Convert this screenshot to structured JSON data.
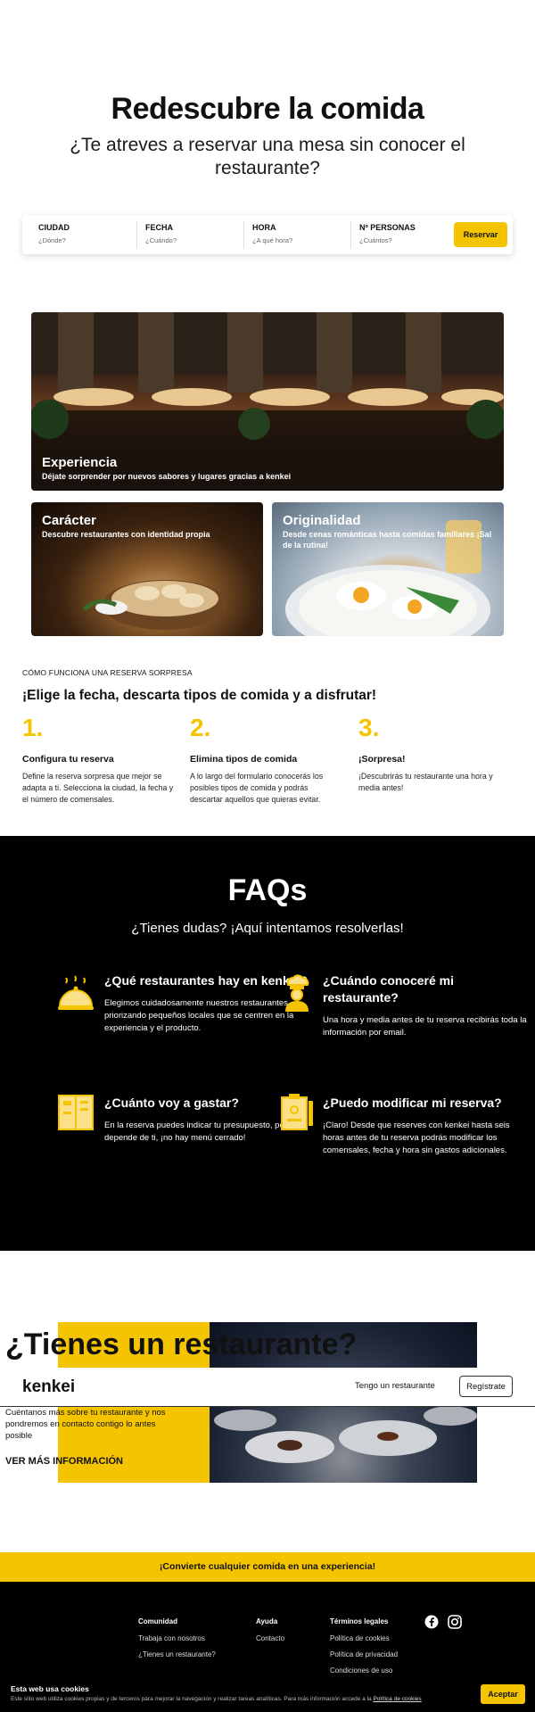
{
  "hero": {
    "title": "Redescubre la comida",
    "subtitle": "¿Te atreves a reservar una mesa sin conocer el restaurante?"
  },
  "search": {
    "fields": [
      {
        "label": "CIUDAD",
        "placeholder": "¿Dónde?"
      },
      {
        "label": "FECHA",
        "placeholder": "¿Cuándo?"
      },
      {
        "label": "HORA",
        "placeholder": "¿A qué hora?"
      },
      {
        "label": "Nº PERSONAS",
        "placeholder": "¿Cuántos?"
      }
    ],
    "button": "Reservar"
  },
  "cards": {
    "experience": {
      "title": "Experiencia",
      "desc": "Déjate sorprender por nuevos sabores y lugares gracias a kenkei"
    },
    "character": {
      "title": "Carácter",
      "desc": "Descubre restaurantes con identidad propia"
    },
    "originality": {
      "title": "Originalidad",
      "desc": "Desde cenas románticas hasta comidas familiares ¡Sal de la rutina!"
    }
  },
  "how": {
    "kicker": "CÓMO FUNCIONA UNA RESERVA SORPRESA",
    "title": "¡Elige la fecha, descarta tipos de comida y a disfrutar!",
    "steps": [
      {
        "num": "1.",
        "title": "Configura tu reserva",
        "desc": "Define la reserva sorpresa que mejor se adapta a ti. Selecciona la ciudad, la fecha y el número de comensales."
      },
      {
        "num": "2.",
        "title": "Elimina tipos de comida",
        "desc": "A lo largo del formulario conocerás los posibles tipos de comida y podrás descartar aquellos que quieras evitar."
      },
      {
        "num": "3.",
        "title": "¡Sorpresa!",
        "desc": "¡Descubrirás tu restaurante una hora y media antes!"
      }
    ]
  },
  "faq": {
    "title": "FAQs",
    "subtitle": "¿Tienes dudas? ¡Aquí intentamos resolverlas!",
    "items": [
      {
        "q": "¿Qué restaurantes hay en kenkei?",
        "a": "Elegimos cuidadosamente nuestros restaurantes priorizando pequeños locales que se centren en la experiencia y el producto."
      },
      {
        "q": "¿Cuándo conoceré mi restaurante?",
        "a": "Una hora y media antes de tu reserva recibirás toda la información por email."
      },
      {
        "q": "¿Cuánto voy a gastar?",
        "a": "En la reserva puedes indicar tu presupuesto, pero depende de ti, ¡no hay menú cerrado!"
      },
      {
        "q": "¿Puedo modificar mi reserva?",
        "a": "¡Claro! Desde que reserves con kenkei hasta seis horas antes de tu reserva podrás modificar los comensales, fecha y hora sin gastos adicionales."
      }
    ]
  },
  "restaurant": {
    "title": "¿Tienes un restaurante?",
    "desc": "Cuéntanos más sobre tu restaurante y nos pondremos en contacto contigo lo antes posible",
    "link": "VER MÁS INFORMACIÓN"
  },
  "nav": {
    "logo": "kenkei",
    "link": "Tengo un restaurante",
    "button": "Regístrate"
  },
  "cta": "¡Convierte cualquier comida en una experiencia!",
  "footer": {
    "columns": [
      {
        "heading": "Comunidad",
        "links": [
          "Trabaja con nosotros",
          "¿Tienes un restaurante?"
        ]
      },
      {
        "heading": "Ayuda",
        "links": [
          "Contacto"
        ]
      },
      {
        "heading": "Términos legales",
        "links": [
          "Política de cookies",
          "Política de privacidad",
          "Condiciones de uso"
        ]
      }
    ],
    "social": [
      "facebook-icon",
      "instagram-icon"
    ]
  },
  "cookie": {
    "title": "Esta web usa cookies",
    "text": "Este sitio web utiliza cookies propias y de terceros para mejorar la navegación y realizar tareas analíticas. Para más información accede a la",
    "link": "Política de cookies",
    "button": "Aceptar"
  },
  "colors": {
    "accent": "#f5c400",
    "dark": "#000000"
  }
}
